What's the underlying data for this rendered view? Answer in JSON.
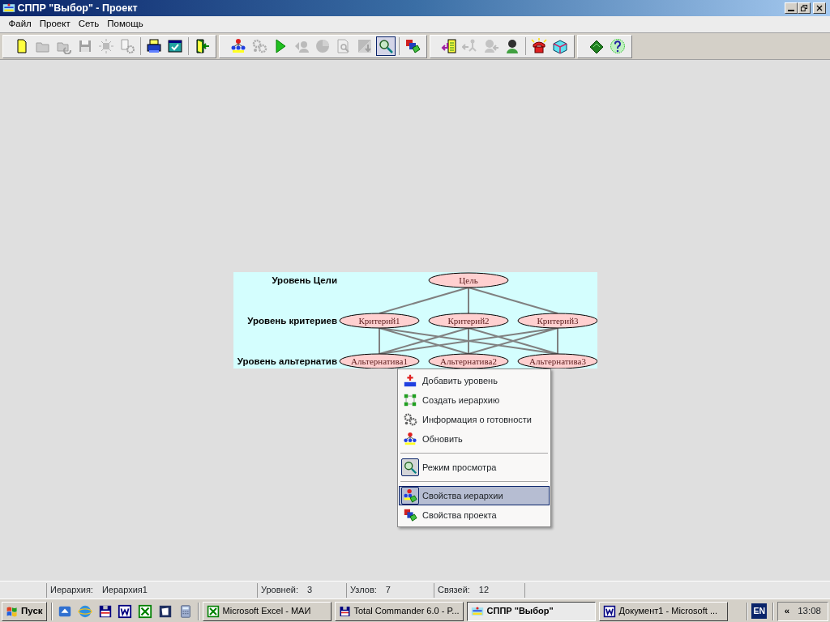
{
  "window": {
    "title": "СППР \"Выбор\" - Проект"
  },
  "menu": [
    {
      "label": "Файл"
    },
    {
      "label": "Проект"
    },
    {
      "label": "Сеть"
    },
    {
      "label": "Помощь"
    }
  ],
  "toolbars": [
    {
      "buttons": [
        {
          "kind": "button",
          "disabled": false,
          "pressed": false
        },
        {
          "kind": "button",
          "disabled": true,
          "pressed": false
        },
        {
          "kind": "button",
          "disabled": true,
          "pressed": false
        },
        {
          "kind": "button",
          "disabled": true,
          "pressed": false
        },
        {
          "kind": "button",
          "disabled": true,
          "pressed": false
        },
        {
          "kind": "button",
          "disabled": true,
          "pressed": false
        },
        {
          "kind": "separator"
        },
        {
          "kind": "button",
          "disabled": false,
          "pressed": false
        },
        {
          "kind": "button",
          "disabled": false,
          "pressed": false
        },
        {
          "kind": "separator"
        },
        {
          "kind": "button",
          "disabled": false,
          "pressed": false
        }
      ]
    },
    {
      "buttons": [
        {
          "kind": "button",
          "disabled": false,
          "pressed": false
        },
        {
          "kind": "button",
          "disabled": true,
          "pressed": false
        },
        {
          "kind": "button",
          "disabled": false,
          "pressed": false
        },
        {
          "kind": "button",
          "disabled": true,
          "pressed": false
        },
        {
          "kind": "button",
          "disabled": true,
          "pressed": false
        },
        {
          "kind": "button",
          "disabled": true,
          "pressed": false
        },
        {
          "kind": "button",
          "disabled": true,
          "pressed": false
        },
        {
          "kind": "button",
          "disabled": false,
          "pressed": true
        },
        {
          "kind": "separator"
        },
        {
          "kind": "button",
          "disabled": false,
          "pressed": false
        }
      ]
    },
    {
      "buttons": [
        {
          "kind": "button",
          "disabled": false,
          "pressed": false
        },
        {
          "kind": "button",
          "disabled": true,
          "pressed": false
        },
        {
          "kind": "button",
          "disabled": true,
          "pressed": false
        },
        {
          "kind": "button",
          "disabled": false,
          "pressed": false
        },
        {
          "kind": "separator"
        },
        {
          "kind": "button",
          "disabled": false,
          "pressed": false
        },
        {
          "kind": "button",
          "disabled": false,
          "pressed": false
        }
      ]
    },
    {
      "buttons": [
        {
          "kind": "button",
          "disabled": false,
          "pressed": false
        },
        {
          "kind": "button",
          "disabled": false,
          "pressed": false
        }
      ]
    }
  ],
  "hierarchy": {
    "levels": [
      {
        "label": "Уровень Цели",
        "nodes": [
          "Цель"
        ]
      },
      {
        "label": "Уровень критериев",
        "nodes": [
          "Критерий1",
          "Критерий2",
          "Критерий3"
        ]
      },
      {
        "label": "Уровень альтернатив",
        "nodes": [
          "Альтернатива1",
          "Альтернатива2",
          "Альтернатива3"
        ]
      }
    ]
  },
  "context_menu": {
    "items": [
      {
        "kind": "item",
        "label": "Добавить уровень",
        "selected": false,
        "checked": false
      },
      {
        "kind": "item",
        "label": "Создать иерархию",
        "selected": false,
        "checked": false
      },
      {
        "kind": "item",
        "label": "Информация о готовности",
        "selected": false,
        "checked": false
      },
      {
        "kind": "item",
        "label": "Обновить",
        "selected": false,
        "checked": false
      },
      {
        "kind": "separator"
      },
      {
        "kind": "item",
        "label": "Режим просмотра",
        "selected": false,
        "checked": true
      },
      {
        "kind": "separator"
      },
      {
        "kind": "item",
        "label": "Свойства иерархии",
        "selected": true,
        "checked": false
      },
      {
        "kind": "item",
        "label": "Свойства проекта",
        "selected": false,
        "checked": false
      }
    ]
  },
  "status_bar": [
    {
      "label": "Иерархия:",
      "value": "Иерархия1"
    },
    {
      "label": "Уровней:",
      "value": "3"
    },
    {
      "label": "Узлов:",
      "value": "7"
    },
    {
      "label": "Связей:",
      "value": "12"
    }
  ],
  "taskbar": {
    "start": "Пуск",
    "tasks": [
      {
        "label": "Microsoft Excel - МАИ",
        "selected": false
      },
      {
        "label": "Total Commander 6.0 - P...",
        "selected": false
      },
      {
        "label": "СППР \"Выбор\"",
        "selected": true
      },
      {
        "label": "Документ1 - Microsoft ...",
        "selected": false
      }
    ],
    "language": "EN",
    "tray_toggle": "«",
    "clock": "13:08"
  }
}
